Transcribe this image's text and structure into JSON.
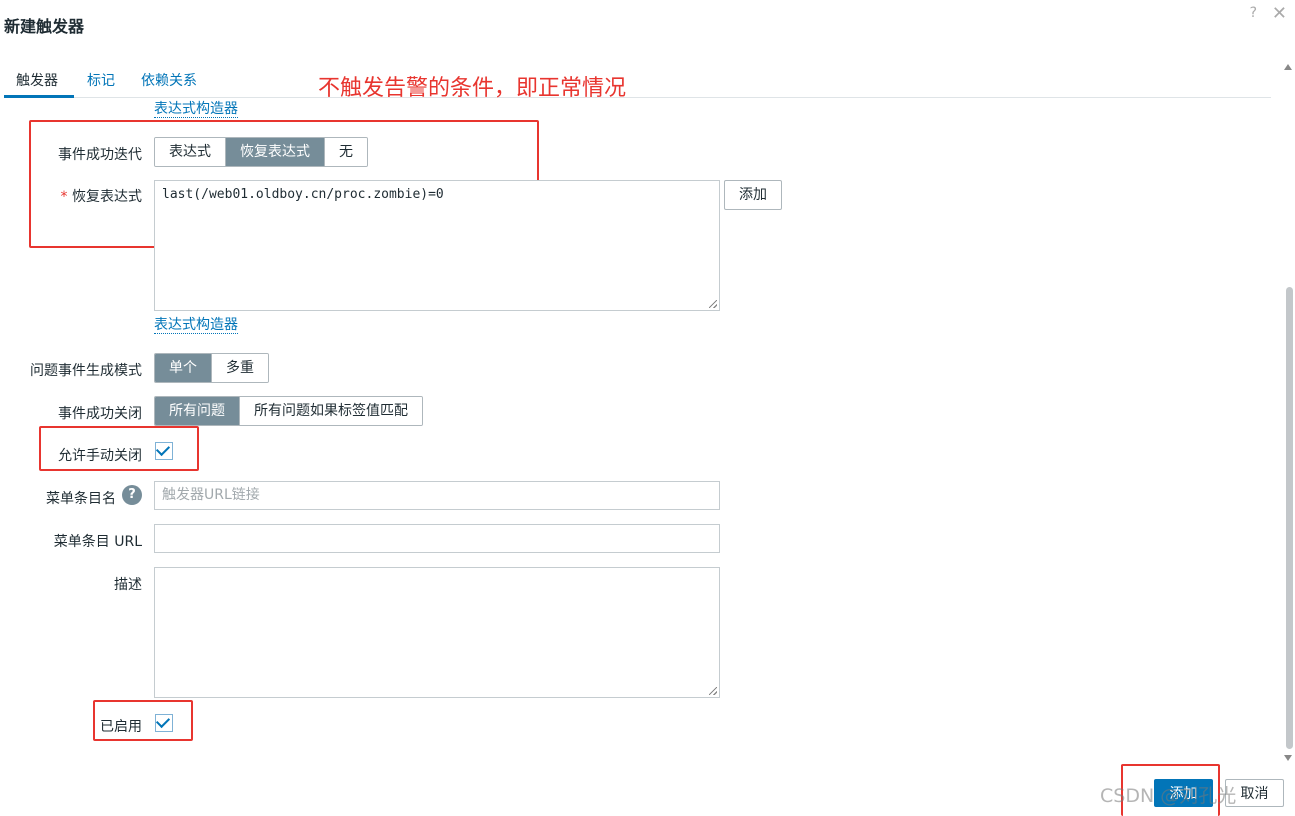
{
  "dialog": {
    "title": "新建触发器",
    "help_glyph": "?",
    "close_glyph": "✕"
  },
  "tabs": [
    {
      "label": "触发器",
      "active": true
    },
    {
      "label": "标记",
      "active": false
    },
    {
      "label": "依赖关系",
      "active": false
    }
  ],
  "annotation": "不触发告警的条件，即正常情况",
  "form": {
    "expr_builder_link_top": "表达式构造器",
    "ok_event_generation": {
      "label": "事件成功迭代",
      "options": [
        "表达式",
        "恢复表达式",
        "无"
      ],
      "selected": "恢复表达式"
    },
    "recovery_expression": {
      "required_mark": "*",
      "label": "恢复表达式",
      "value": "last(/web01.oldboy.cn/proc.zombie)=0",
      "add_button": "添加"
    },
    "expr_builder_link": "表达式构造器",
    "problem_event_mode": {
      "label": "问题事件生成模式",
      "options": [
        "单个",
        "多重"
      ],
      "selected": "单个"
    },
    "ok_event_closes": {
      "label": "事件成功关闭",
      "options": [
        "所有问题",
        "所有问题如果标签值匹配"
      ],
      "selected": "所有问题"
    },
    "allow_manual_close": {
      "label": "允许手动关闭",
      "checked": true
    },
    "menu_entry_name": {
      "label": "菜单条目名",
      "help_glyph": "?",
      "placeholder": "触发器URL链接",
      "value": ""
    },
    "menu_entry_url": {
      "label": "菜单条目 URL",
      "value": ""
    },
    "description": {
      "label": "描述",
      "value": ""
    },
    "enabled": {
      "label": "已启用",
      "checked": true
    }
  },
  "footer": {
    "add_button": "添加",
    "cancel_button": "取消"
  },
  "watermark": "CSDN @刘孔光"
}
